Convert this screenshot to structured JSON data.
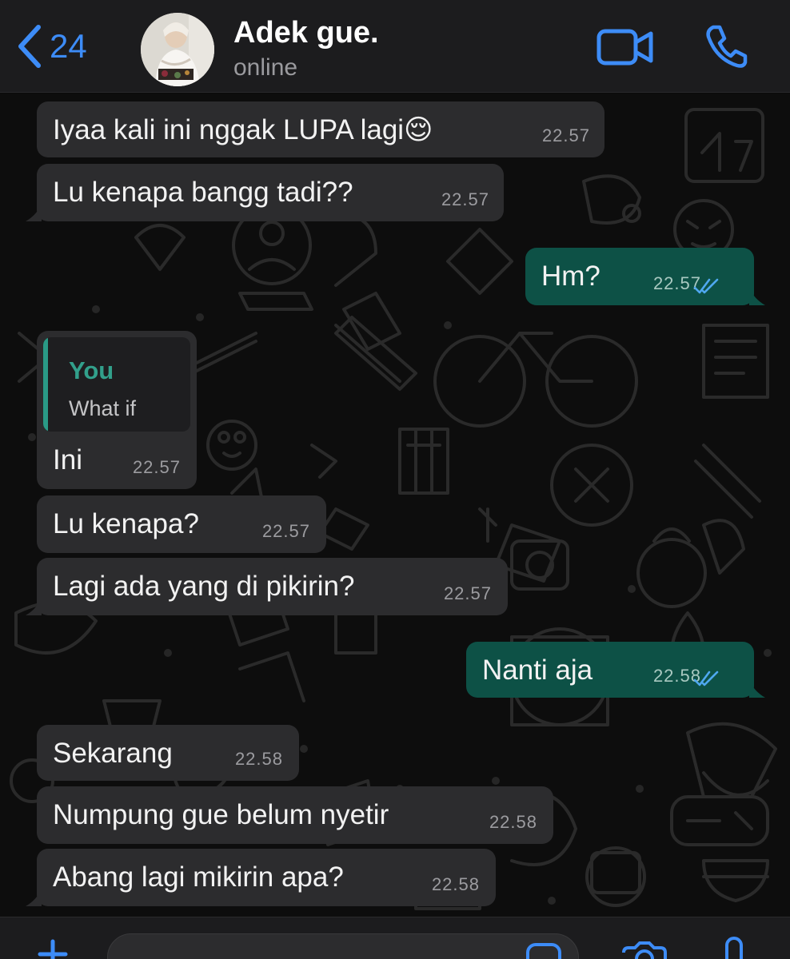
{
  "header": {
    "back_count": "24",
    "contact_name": "Adek gue.",
    "status": "online"
  },
  "icons": {
    "back": "chevron-left-icon",
    "video": "video-camera-icon",
    "phone": "phone-icon",
    "ticks": "double-check-icon",
    "attach": "plus-icon",
    "sticker": "sticker-icon",
    "camera": "camera-icon",
    "mic": "microphone-icon"
  },
  "colors": {
    "accent_blue": "#3d8cf7",
    "incoming_bubble": "#2c2c2e",
    "outgoing_bubble": "#0d5146",
    "quote_author": "#32a08b"
  },
  "messages": [
    {
      "text": "Iyaa kali ini nggak LUPA lagi😌",
      "time": "22.57"
    },
    {
      "text": "Lu kenapa bangg tadi??",
      "time": "22.57"
    },
    {
      "text": "Hm?",
      "time": "22.57"
    },
    {
      "quote_author": "You",
      "quote_text": "What if",
      "text": "Ini",
      "time": "22.57"
    },
    {
      "text": "Lu kenapa?",
      "time": "22.57"
    },
    {
      "text": "Lagi ada yang di pikirin?",
      "time": "22.57"
    },
    {
      "text": "Nanti aja",
      "time": "22.58"
    },
    {
      "text": "Sekarang",
      "time": "22.58"
    },
    {
      "text": "Numpung gue belum nyetir",
      "time": "22.58"
    },
    {
      "text": "Abang lagi mikirin apa?",
      "time": "22.58"
    }
  ],
  "composer": {
    "value": ""
  }
}
